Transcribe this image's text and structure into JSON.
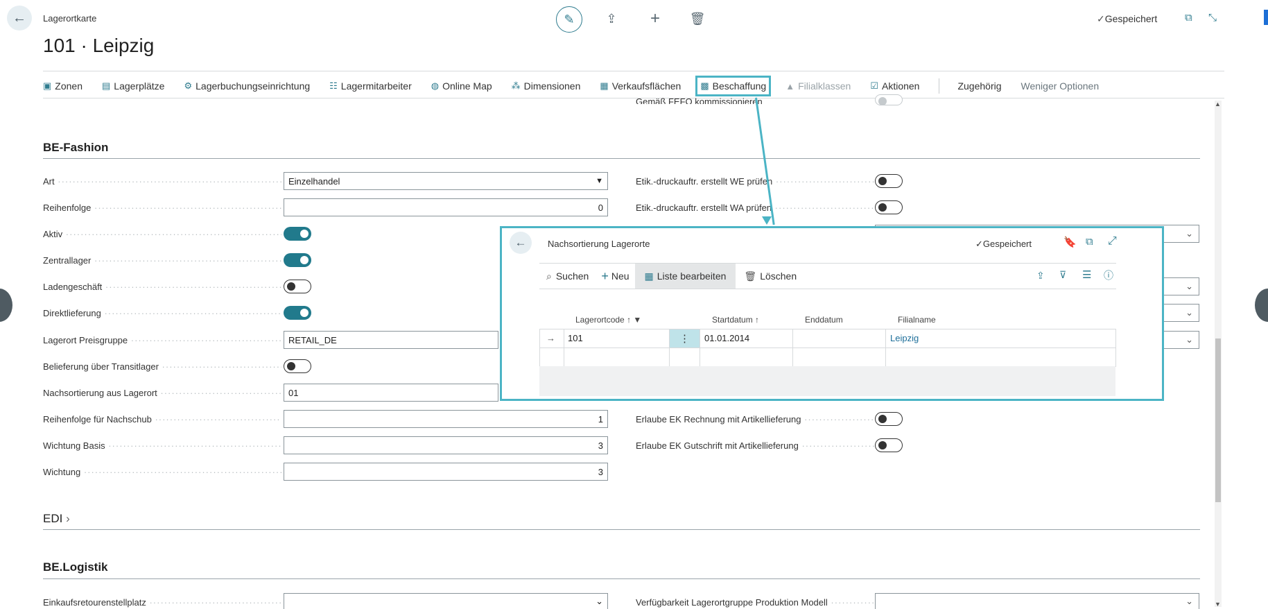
{
  "header": {
    "breadcrumb": "Lagerortkarte",
    "title": "101 · Leipzig",
    "saved": "Gespeichert"
  },
  "actions": [
    {
      "label": "Zonen",
      "icon": "zones-icon"
    },
    {
      "label": "Lagerplätze",
      "icon": "bins-icon"
    },
    {
      "label": "Lagerbuchungseinrichtung",
      "icon": "posting-setup-icon"
    },
    {
      "label": "Lagermitarbeiter",
      "icon": "employee-icon"
    },
    {
      "label": "Online Map",
      "icon": "globe-icon"
    },
    {
      "label": "Dimensionen",
      "icon": "dimensions-icon"
    },
    {
      "label": "Verkaufsflächen",
      "icon": "sales-area-icon"
    },
    {
      "label": "Beschaffung",
      "icon": "procurement-icon"
    },
    {
      "label": "Filialklassen",
      "icon": "store-class-icon"
    },
    {
      "label": "Aktionen",
      "icon": "actions-icon"
    },
    {
      "label": "Zugehörig",
      "icon": ""
    },
    {
      "label": "Weniger Optionen",
      "icon": ""
    }
  ],
  "top_cut_label": "Gemäß FEFO kommissionieren",
  "sections": {
    "be_fashion": "BE-Fashion",
    "edi": "EDI",
    "be_logistik": "BE.Logistik"
  },
  "fields": {
    "art": {
      "label": "Art",
      "value": "Einzelhandel"
    },
    "reihenfolge": {
      "label": "Reihenfolge",
      "value": "0"
    },
    "aktiv": {
      "label": "Aktiv"
    },
    "zentrallager": {
      "label": "Zentrallager"
    },
    "ladengeschaeft": {
      "label": "Ladengeschäft"
    },
    "direktlieferung": {
      "label": "Direktlieferung"
    },
    "preisgruppe": {
      "label": "Lagerort Preisgruppe",
      "value": "RETAIL_DE"
    },
    "transitlager": {
      "label": "Belieferung über Transitlager"
    },
    "nachsortierung": {
      "label": "Nachsortierung aus Lagerort",
      "value": "01"
    },
    "reihenfolge_nachschub": {
      "label": "Reihenfolge für Nachschub",
      "value": "1"
    },
    "wichtung_basis": {
      "label": "Wichtung Basis",
      "value": "3"
    },
    "wichtung": {
      "label": "Wichtung",
      "value": "3"
    },
    "einkaufsretoure": {
      "label": "Einkaufsretourenstellplatz",
      "value": ""
    }
  },
  "right_fields": {
    "etik_we": "Etik.-druckauftr. erstellt WE prüfen",
    "etik_wa": "Etik.-druckauftr. erstellt WA prüfen",
    "ek_rechnung": "Erlaube EK Rechnung mit Artikellieferung",
    "ek_gutschrift": "Erlaube EK Gutschrift mit Artikellieferung",
    "verfuegbarkeit": "Verfügbarkeit Lagerortgruppe Produktion Modell"
  },
  "popup": {
    "title": "Nachsortierung Lagerorte",
    "saved": "Gespeichert",
    "toolbar": {
      "search": "Suchen",
      "new": "Neu",
      "edit_list": "Liste bearbeiten",
      "delete": "Löschen"
    },
    "columns": {
      "code": "Lagerortcode",
      "start": "Startdatum",
      "end": "Enddatum",
      "name": "Filialname"
    },
    "rows": [
      {
        "code": "101",
        "start": "01.01.2014",
        "end": "",
        "name": "Leipzig"
      }
    ]
  },
  "colors": {
    "accent": "#217a8c",
    "highlight": "#4bb4c5"
  }
}
